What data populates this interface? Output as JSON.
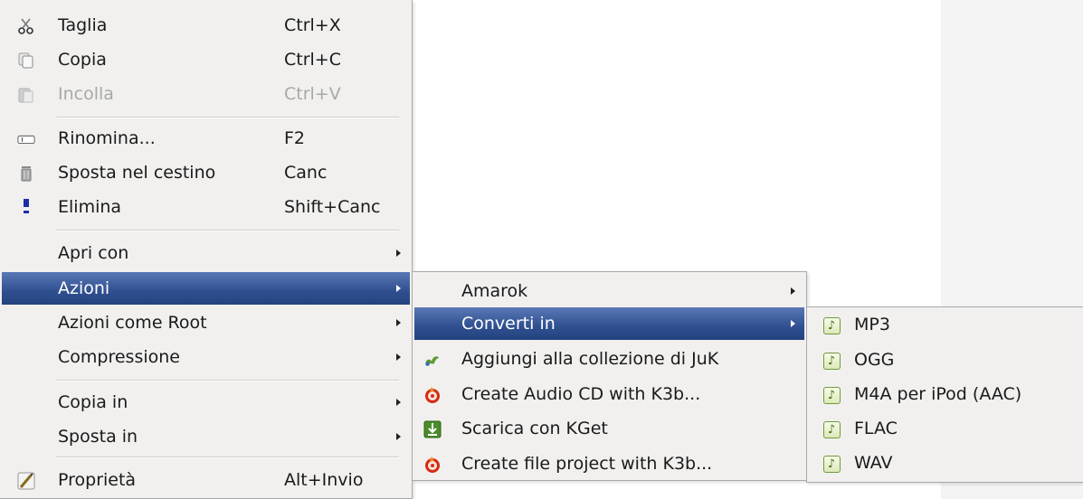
{
  "main_menu": {
    "items": [
      {
        "label": "Taglia",
        "accel": "Ctrl+X",
        "icon": "scissors-icon"
      },
      {
        "label": "Copia",
        "accel": "Ctrl+C",
        "icon": "copy-icon"
      },
      {
        "label": "Incolla",
        "accel": "Ctrl+V",
        "icon": "paste-icon"
      },
      {
        "label": "Rinomina...",
        "accel": "F2",
        "icon": "rename-icon"
      },
      {
        "label": "Sposta nel cestino",
        "accel": "Canc",
        "icon": "trash-icon"
      },
      {
        "label": "Elimina",
        "accel": "Shift+Canc",
        "icon": "delete-icon"
      },
      {
        "label": "Apri con"
      },
      {
        "label": "Azioni"
      },
      {
        "label": "Azioni come Root"
      },
      {
        "label": "Compressione"
      },
      {
        "label": "Copia in"
      },
      {
        "label": "Sposta in"
      },
      {
        "label": "Proprietà",
        "accel": "Alt+Invio",
        "icon": "properties-icon"
      }
    ]
  },
  "actions_submenu": {
    "items": [
      {
        "label": "Amarok"
      },
      {
        "label": "Converti in"
      },
      {
        "label": "Aggiungi alla collezione di JuK",
        "icon": "juk-icon"
      },
      {
        "label": "Create Audio CD with K3b...",
        "icon": "k3b-icon"
      },
      {
        "label": "Scarica con KGet",
        "icon": "kget-icon"
      },
      {
        "label": "Create file project with K3b...",
        "icon": "k3b-icon"
      }
    ]
  },
  "convert_submenu": {
    "items": [
      {
        "label": "MP3",
        "icon": "music-note-icon"
      },
      {
        "label": "OGG",
        "icon": "music-note-icon"
      },
      {
        "label": "M4A per iPod (AAC)",
        "icon": "music-note-icon"
      },
      {
        "label": "FLAC",
        "icon": "music-note-icon"
      },
      {
        "label": "WAV",
        "icon": "music-note-icon"
      }
    ]
  },
  "colors": {
    "menu_bg": "#f1f0ef",
    "highlight": "#2f4f8f",
    "disabled_text": "#a8a8a8"
  }
}
